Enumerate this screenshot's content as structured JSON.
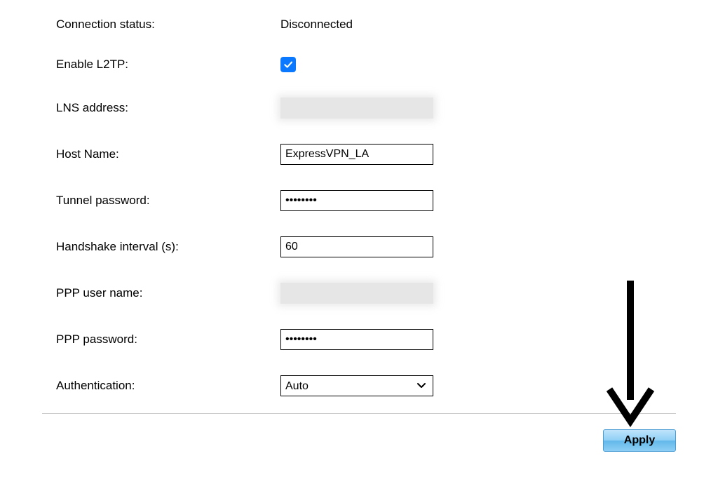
{
  "form": {
    "connection_status_label": "Connection status:",
    "connection_status_value": "Disconnected",
    "enable_l2tp_label": "Enable L2TP:",
    "enable_l2tp_checked": true,
    "lns_address_label": "LNS address:",
    "lns_address_value": "",
    "host_name_label": "Host Name:",
    "host_name_value": "ExpressVPN_LA",
    "tunnel_password_label": "Tunnel password:",
    "tunnel_password_value": "••••••••",
    "handshake_interval_label": "Handshake interval (s):",
    "handshake_interval_value": "60",
    "ppp_user_name_label": "PPP user name:",
    "ppp_user_name_value": "",
    "ppp_password_label": "PPP password:",
    "ppp_password_value": "••••••••",
    "authentication_label": "Authentication:",
    "authentication_value": "Auto"
  },
  "actions": {
    "apply_label": "Apply"
  },
  "icons": {
    "check": "check-icon",
    "chevron_down": "chevron-down-icon",
    "annotation_arrow": "annotation-arrow-icon"
  }
}
